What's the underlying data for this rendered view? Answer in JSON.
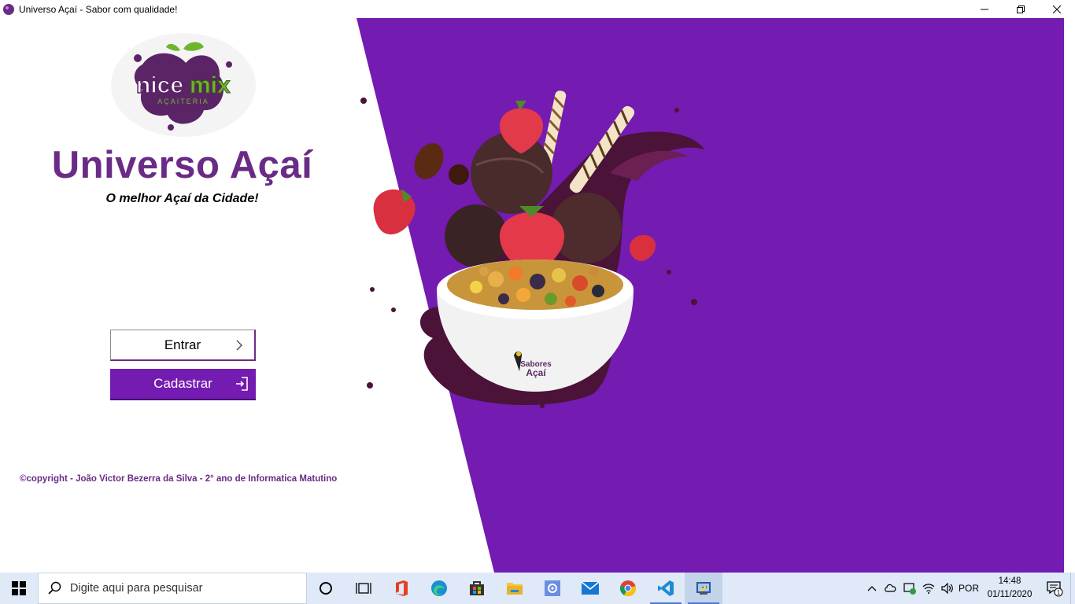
{
  "window": {
    "title": "Universo Açaí - Sabor com qualidade!",
    "controls": {
      "minimize": "—",
      "restore": "❐",
      "close": "✕"
    }
  },
  "logo": {
    "brand_nice": "nice",
    "brand_mix": "mix",
    "brand_sub": "AÇAITERIA"
  },
  "hero": {
    "title": "Universo Açaí",
    "subtitle": "O melhor Açaí da Cidade!"
  },
  "buttons": {
    "entrar": "Entrar",
    "cadastrar": "Cadastrar"
  },
  "footer": {
    "copyright": "©copyright - João Victor Bezerra da Silva - 2° ano de Informatica Matutino"
  },
  "bowl": {
    "brand_line1": "Sabores",
    "brand_line2": "Açaí"
  },
  "taskbar": {
    "search_placeholder": "Digite aqui para pesquisar",
    "language": "POR",
    "time": "14:48",
    "date": "01/11/2020",
    "notification_count": "1"
  },
  "colors": {
    "accent_purple": "#741bb2",
    "title_purple": "#6a2b86",
    "taskbar_bg": "#dfe9f7"
  }
}
